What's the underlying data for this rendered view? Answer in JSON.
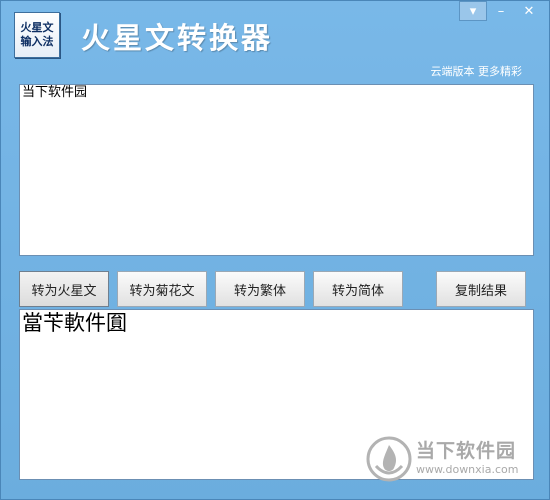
{
  "app": {
    "logo_line1": "火星文",
    "logo_line2": "输入法",
    "title": "火星文转换器"
  },
  "window_controls": {
    "menu": "▾",
    "minimize": "–",
    "close": "✕"
  },
  "cloud_link": "云端版本 更多精彩",
  "input_text": "当下软件园",
  "buttons": {
    "to_martian": "转为火星文",
    "to_chrysanthemum": "转为菊花文",
    "to_traditional": "转为繁体",
    "to_simplified": "转为简体",
    "copy_result": "复制结果"
  },
  "output_text": "當苄軟件圎",
  "watermark": {
    "title": "当下软件园",
    "url": "www.downxia.com"
  },
  "colors": {
    "window_bg": "#6fb0e2",
    "title_text": "#ffffff",
    "watermark": "#a9a9a9"
  }
}
